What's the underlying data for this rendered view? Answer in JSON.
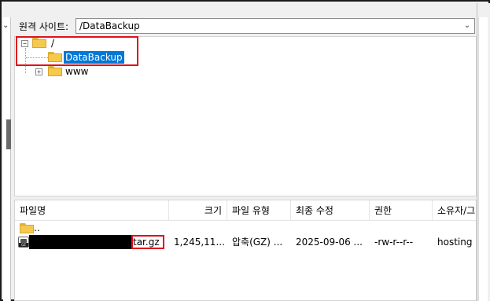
{
  "remote_site": {
    "label": "원격 사이트:",
    "path": "/DataBackup"
  },
  "tree": {
    "root": {
      "label": "/",
      "expanded": true
    },
    "children": [
      {
        "label": "DataBackup",
        "selected": true
      },
      {
        "label": "www",
        "expandable": true
      }
    ]
  },
  "file_list": {
    "columns": [
      "파일명",
      "크기",
      "파일 유형",
      "최종 수정",
      "권한",
      "소유자/그"
    ],
    "rows": [
      {
        "name": "..",
        "size": "",
        "type": "",
        "modified": "",
        "permissions": "",
        "owner": "",
        "icon": "folder-icon"
      },
      {
        "name": "tar.gz",
        "name_redacted": true,
        "size": "1,245,11...",
        "type": "압축(GZ) ...",
        "modified": "2025-09-06 ...",
        "permissions": "-rw-r--r--",
        "owner": "hosting h",
        "icon": "archive-icon",
        "icon_text": "GZ"
      }
    ]
  },
  "colors": {
    "selection": "#0078d7",
    "highlight_box": "#e0101a",
    "folder": "#f6c94c"
  }
}
